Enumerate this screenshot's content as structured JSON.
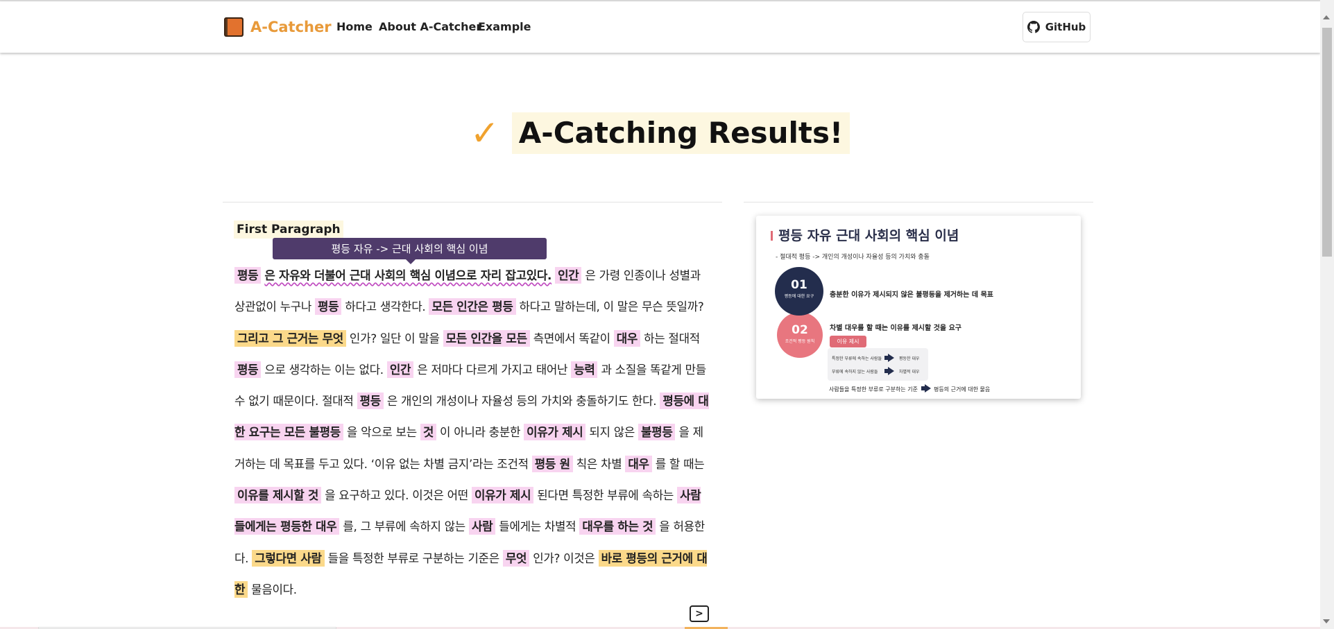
{
  "navbar": {
    "brand": "A-Catcher",
    "links": [
      "Home",
      "About A-Catcher",
      "Example"
    ],
    "github_label": "GitHub"
  },
  "hero": {
    "check": "✓",
    "title": "A-Catching Results!"
  },
  "paragraph": {
    "label": "First Paragraph",
    "tooltip": "평등 자유 -> 근대 사회의 핵심 이념",
    "segments": [
      {
        "text": "평등",
        "style": "hl"
      },
      {
        "text": " ",
        "style": "plain"
      },
      {
        "text": "은 자유와 더불어 근대 사회의 핵심 이념으로 자리 잡고있다.",
        "style": "wavy"
      },
      {
        "text": " ",
        "style": "plain"
      },
      {
        "text": "인간",
        "style": "hl"
      },
      {
        "text": " 은 가령 인종이나 성별과 상관없이 누구나 ",
        "style": "plain"
      },
      {
        "text": "평등",
        "style": "hl"
      },
      {
        "text": " 하다고 생각한다. ",
        "style": "plain"
      },
      {
        "text": "모든 인간은 평등",
        "style": "hl"
      },
      {
        "text": " 하다고 말하는데, 이 말은 무슨 뜻일까? ",
        "style": "plain"
      },
      {
        "text": "그리고 그 근거는 무엇",
        "style": "hy"
      },
      {
        "text": " 인가? 일단 이 말을 ",
        "style": "plain"
      },
      {
        "text": "모든 인간을 모든",
        "style": "hl"
      },
      {
        "text": " 측면에서 똑같이 ",
        "style": "plain"
      },
      {
        "text": "대우",
        "style": "hl"
      },
      {
        "text": " 하는 절대적 ",
        "style": "plain"
      },
      {
        "text": "평등",
        "style": "hl"
      },
      {
        "text": " 으로 생각하는 이는 없다. ",
        "style": "plain"
      },
      {
        "text": "인간",
        "style": "hl"
      },
      {
        "text": " 은 저마다 다르게 가지고 태어난 ",
        "style": "plain"
      },
      {
        "text": "능력",
        "style": "hl"
      },
      {
        "text": " 과 소질을 똑같게 만들 수 없기 때문이다. 절대적 ",
        "style": "plain"
      },
      {
        "text": "평등",
        "style": "hl"
      },
      {
        "text": " 은 개인의 개성이나 자율성 등의 가치와 충돌하기도 한다. ",
        "style": "plain"
      },
      {
        "text": "평등에 대한 요구는 모든 불평등",
        "style": "hl"
      },
      {
        "text": " 을 악으로 보는 ",
        "style": "plain"
      },
      {
        "text": "것",
        "style": "hl"
      },
      {
        "text": " 이 아니라 충분한 ",
        "style": "plain"
      },
      {
        "text": "이유가 제시",
        "style": "hl"
      },
      {
        "text": " 되지 않은 ",
        "style": "plain"
      },
      {
        "text": "불평등",
        "style": "hl"
      },
      {
        "text": " 을 제거하는 데 목표를 두고 있다. ‘이유 없는 차별 금지’라는 조건적 ",
        "style": "plain"
      },
      {
        "text": "평등 원",
        "style": "hl"
      },
      {
        "text": " 칙은 차별 ",
        "style": "plain"
      },
      {
        "text": "대우",
        "style": "hl"
      },
      {
        "text": " 를 할 때는 ",
        "style": "plain"
      },
      {
        "text": "이유를 제시할 것",
        "style": "hl"
      },
      {
        "text": " 을 요구하고 있다. 이것은 어떤 ",
        "style": "plain"
      },
      {
        "text": "이유가 제시",
        "style": "hl"
      },
      {
        "text": " 된다면 특정한 부류에 속하는 ",
        "style": "plain"
      },
      {
        "text": "사람들에게는 평등한 대우",
        "style": "hl"
      },
      {
        "text": " 를, 그 부류에 속하지 않는 ",
        "style": "plain"
      },
      {
        "text": "사람",
        "style": "hl"
      },
      {
        "text": " 들에게는 차별적 ",
        "style": "plain"
      },
      {
        "text": "대우를 하는 것",
        "style": "hl"
      },
      {
        "text": " 을 허용한다. ",
        "style": "plain"
      },
      {
        "text": "그렇다면 사람",
        "style": "hy"
      },
      {
        "text": " 들을 특정한 부류로 구분하는 기준은 ",
        "style": "plain"
      },
      {
        "text": "무엇",
        "style": "hl"
      },
      {
        "text": " 인가? 이것은 ",
        "style": "plain"
      },
      {
        "text": "바로 평등의 근거에 대한",
        "style": "hy"
      },
      {
        "text": " 물음이다.",
        "style": "plain"
      }
    ],
    "next_icon": "chevron-right-icon"
  },
  "slide": {
    "title": "평등 자유 근대 사회의 핵심 이념",
    "subtitle": "- 절대적 평등 -> 개인의 개성이나 자율성 등의 가치와 충돌",
    "item1": {
      "num": "01",
      "caption": "평등에 대한 요구",
      "text": "충분한 이유가 제시되지 않은 불평등을 제거하는 데 목표"
    },
    "item2": {
      "num": "02",
      "caption": "조건적 평등 원칙",
      "text": "차별 대우를 할 때는 이유를 제시할 것을 요구"
    },
    "reason_badge": "이유 제시",
    "compare": [
      {
        "left": "특정한 부류에 속하는 사람들",
        "right": "평등한 대우"
      },
      {
        "left": "부류에 속하지 않는 사람들",
        "right": "차별적 대우"
      }
    ],
    "bottom_left": "사람들을 특정한 부류로 구분하는 기준",
    "bottom_right": "평등의 근거에 대한 물음"
  },
  "colors": {
    "brand": "#e89a3a",
    "highlight_pink": "#f8d4f0",
    "highlight_yellow": "#fbd98a",
    "tooltip": "#4f3b6b",
    "slide_navy": "#232d4d",
    "slide_red": "#e8767f"
  }
}
